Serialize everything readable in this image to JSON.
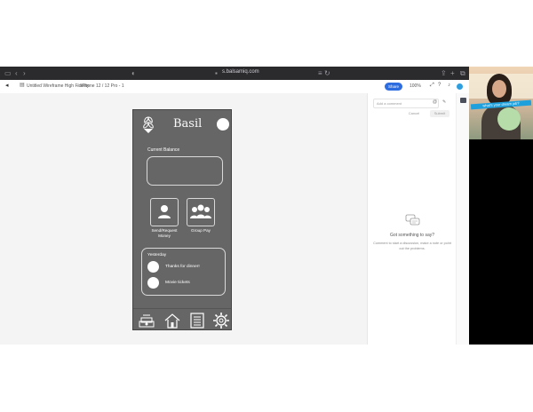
{
  "browser": {
    "url": "s.balsamiq.com",
    "breadcrumb_project": "Untitled Wireframe High Fidelity",
    "breadcrumb_page": "iPhone 12 / 12 Pro - 1",
    "share_label": "Share",
    "zoom": "100%"
  },
  "phone": {
    "brand": "Basil",
    "balance_label": "Current Balance",
    "send_label_line1": "Send/Request",
    "send_label_line2": "Money",
    "group_label": "Group Pay",
    "yesterday_label": "Yesterday",
    "transactions": [
      "Thanks for dinner!",
      "Movie tickets"
    ]
  },
  "comments": {
    "input_placeholder": "Add a comment",
    "cancel_label": "Cancel",
    "submit_label": "Submit",
    "empty_title": "Got something to say?",
    "empty_subtitle": "Comment to start a discussion, make a note or point out the problems."
  },
  "video": {
    "banner": "what's your dream job?"
  },
  "colors": {
    "phone_bg": "#666666",
    "accent": "#2d6de0",
    "video_circle": "#b6dca9"
  }
}
